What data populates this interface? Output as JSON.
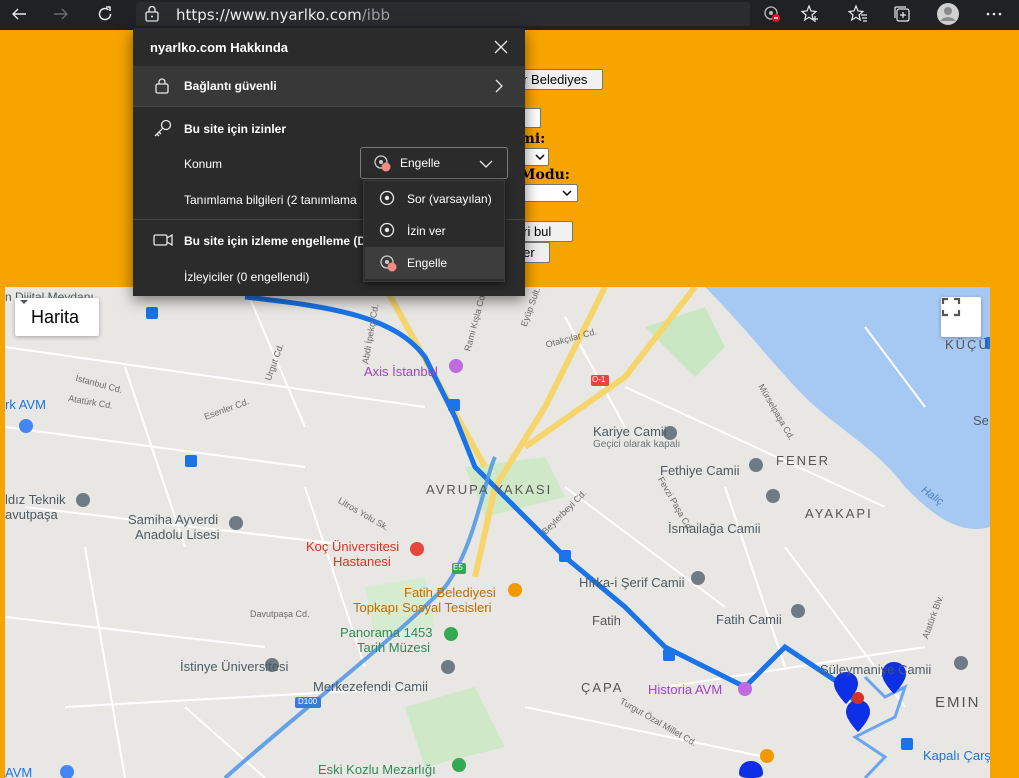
{
  "browser": {
    "url_host": "https://www.nyarlko.com",
    "url_path": "/ibb",
    "icons": [
      "back-icon",
      "forward-icon",
      "refresh-icon",
      "lock-icon",
      "location-blocked-icon",
      "favorite-add-icon",
      "favorites-icon",
      "collections-icon",
      "profile-icon",
      "more-icon"
    ]
  },
  "page_form": {
    "button_top": "hir Belediyes",
    "label_1": "mi:",
    "label_2": "Modu:",
    "button_find": "leri bul",
    "button_show": "ster"
  },
  "popup": {
    "title": "nyarlko.com Hakkında",
    "connection": "Bağlantı güvenli",
    "permissions_heading": "Bu site için izinler",
    "location_label": "Konum",
    "location_value": "Engelle",
    "cookies_label": "Tanımlama bilgileri (2 tanımlama",
    "tracking_heading": "Bu site için izleme engelleme (De",
    "trackers_label": "İzleyiciler (0 engellendi)",
    "dropdown_options": [
      "Sor (varsayılan)",
      "İzin ver",
      "Engelle"
    ]
  },
  "map": {
    "type_button": "Harita",
    "labels": {
      "axis": "Axis İstanbul",
      "kariye": "Kariye Camii",
      "kariye_sub": "Geçici olarak kapalı",
      "fethiye": "Fethiye Camii",
      "fener": "FENER",
      "avrupa": "AVRUPA YAKASI",
      "ayakapi": "AYAKAPI",
      "ismailaga": "İsmailağa Camii",
      "samiha1": "Samiha Ayverdi",
      "samiha2": "Anadolu Lisesi",
      "koc1": "Koç Üniversitesi",
      "koc2": "Hastanesi",
      "fatih_bel1": "Fatih Belediyesi",
      "fatih_bel2": "Topkapı Sosyal Tesisleri",
      "hirka": "Hırka-i Şerif Camii",
      "fatih_camii": "Fatih Camii",
      "fatih": "Fatih",
      "panorama1": "Panorama 1453",
      "panorama2": "Tarih Müzesi",
      "istinye": "İstinye Üniversitesi",
      "merkezefendi": "Merkezefendi Camii",
      "capa": "ÇAPA",
      "historia": "Historia AVM",
      "suleymaniye": "Süleymaniye Camii",
      "emin": "EMIN",
      "kapali": "Kapalı Çarş",
      "eski_kozlu": "Eski Kozlu Mezarlığı",
      "teknik1": "ldız Teknik",
      "teknik2": "avutpaşa",
      "rk_avm": "rk AVM",
      "avm_bottom": "AVM",
      "kucuk": "KÜÇÜ",
      "se": "Se",
      "halic": "Haliç",
      "meydan": "n Dijital Meydanı",
      "istanbul_cd": "İstanbul Cd.",
      "ataturk_cd": "Atatürk Cd.",
      "esenler_cd": "Esenler Cd.",
      "litros": "Litros Yolu Sk.",
      "davutpasa": "Davutpaşa Cd.",
      "abdi": "Abdi İpekçi Cd.",
      "rami": "Rami Kışla Cd.",
      "eyup": "Eyüp Sult.",
      "otakcilar": "Otakçılar Cd.",
      "mursel": "Mürselpaşa Cd.",
      "fevzi": "Fevzi Paşa Cd.",
      "beyler": "Beylerbeyi Cd.",
      "turgut": "Turgut Özal Millet Cd.",
      "ataturk_blv": "Atatürk Blv.",
      "urgut": "Urgut Cd.",
      "d100": "D100",
      "o1": "O-1",
      "e5": "E5"
    }
  }
}
